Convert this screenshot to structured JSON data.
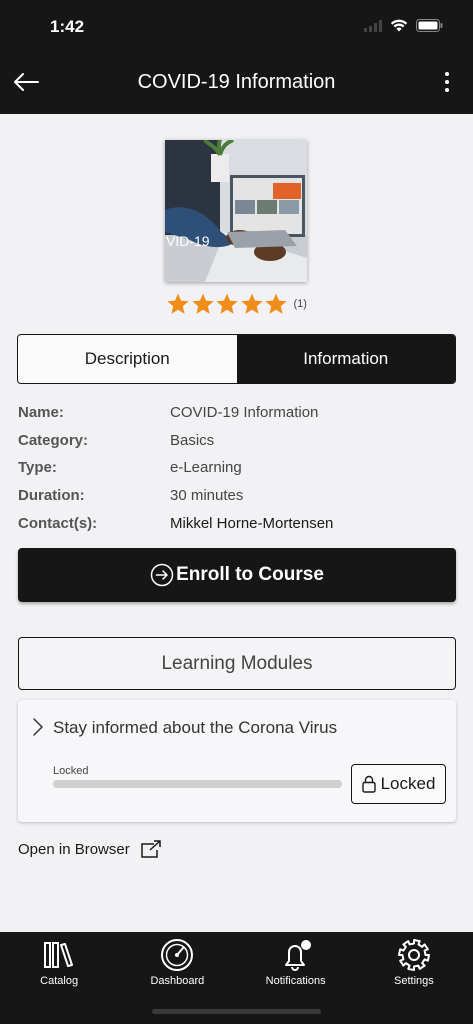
{
  "status_bar": {
    "time": "1:42"
  },
  "app_bar": {
    "title": "COVID-19 Information"
  },
  "course": {
    "image_caption": "VID-19",
    "rating_value": 5,
    "rating_max": 5,
    "rating_count": "(1)"
  },
  "tabs": [
    {
      "label": "Description",
      "active": false
    },
    {
      "label": "Information",
      "active": true
    }
  ],
  "info": {
    "name_label": "Name:",
    "name_value": "COVID-19 Information",
    "category_label": "Category:",
    "category_value": "Basics",
    "type_label": "Type:",
    "type_value": "e-Learning",
    "duration_label": "Duration:",
    "duration_value": "30 minutes",
    "contact_label": "Contact(s):",
    "contact_value": "Mikkel Horne-Mortensen"
  },
  "enroll_label": "Enroll to Course",
  "modules": {
    "header": "Learning Modules",
    "items": [
      {
        "title": "Stay informed about the Corona Virus",
        "progress_label": "Locked",
        "progress": 0,
        "button_label": "Locked"
      }
    ]
  },
  "open_browser_label": "Open in Browser",
  "nav": [
    {
      "label": "Catalog",
      "icon": "catalog-icon"
    },
    {
      "label": "Dashboard",
      "icon": "dashboard-icon"
    },
    {
      "label": "Notifications",
      "icon": "bell-icon",
      "badge": true
    },
    {
      "label": "Settings",
      "icon": "gear-icon"
    }
  ],
  "colors": {
    "bar": "#161616",
    "background": "#f2f2f5",
    "star": "#f08c1a"
  }
}
